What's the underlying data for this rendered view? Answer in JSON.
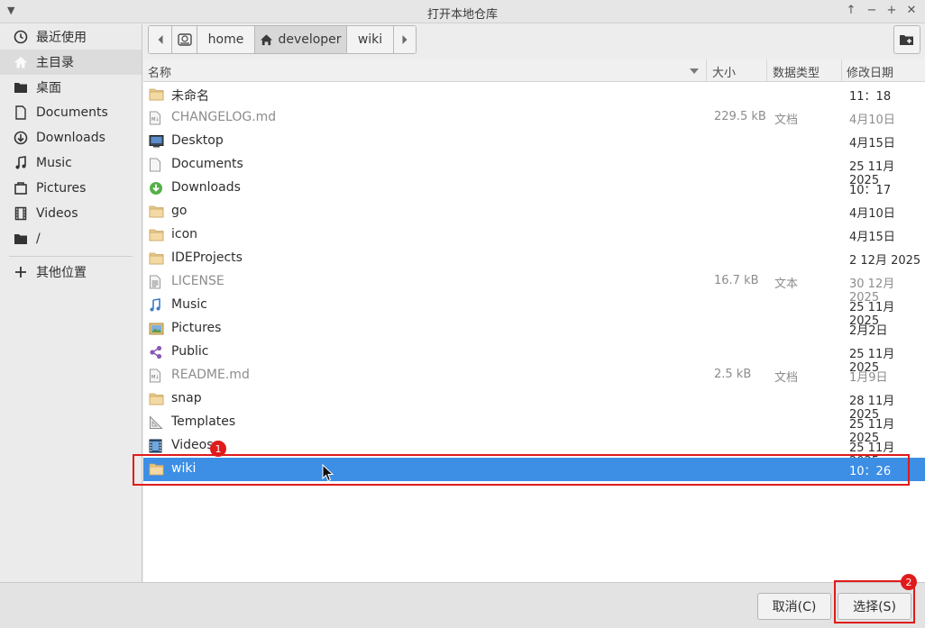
{
  "window": {
    "title": "打开本地仓库",
    "controls": [
      "↑",
      "−",
      "+",
      "✕"
    ]
  },
  "sidebar": {
    "items": [
      {
        "label": "最近使用",
        "icon": "recent-icon"
      },
      {
        "label": "主目录",
        "icon": "home-icon"
      },
      {
        "label": "桌面",
        "icon": "folder-icon"
      },
      {
        "label": "Documents",
        "icon": "document-icon"
      },
      {
        "label": "Downloads",
        "icon": "download-icon"
      },
      {
        "label": "Music",
        "icon": "music-icon"
      },
      {
        "label": "Pictures",
        "icon": "picture-icon"
      },
      {
        "label": "Videos",
        "icon": "video-icon"
      },
      {
        "label": "/",
        "icon": "folder-icon"
      }
    ],
    "other_locations": "其他位置"
  },
  "pathbar": {
    "segments": [
      "home",
      "developer",
      "wiki"
    ]
  },
  "table": {
    "headers": {
      "name": "名称",
      "size": "大小",
      "type": "数据类型",
      "modified": "修改日期"
    },
    "rows": [
      {
        "name": "未命名",
        "size": "",
        "type": "",
        "modified": "11：18",
        "icon": "folder-icon"
      },
      {
        "name": "CHANGELOG.md",
        "size": "229.5 kB",
        "type": "文档",
        "modified": "4月10日",
        "icon": "markdown-file-icon"
      },
      {
        "name": "Desktop",
        "size": "",
        "type": "",
        "modified": "4月15日",
        "icon": "desktop-folder-icon"
      },
      {
        "name": "Documents",
        "size": "",
        "type": "",
        "modified": "25 11月 2025",
        "icon": "documents-folder-icon"
      },
      {
        "name": "Downloads",
        "size": "",
        "type": "",
        "modified": "10：17",
        "icon": "downloads-folder-icon"
      },
      {
        "name": "go",
        "size": "",
        "type": "",
        "modified": "4月10日",
        "icon": "folder-icon"
      },
      {
        "name": "icon",
        "size": "",
        "type": "",
        "modified": "4月15日",
        "icon": "folder-icon"
      },
      {
        "name": "IDEProjects",
        "size": "",
        "type": "",
        "modified": "2 12月 2025",
        "icon": "folder-icon"
      },
      {
        "name": "LICENSE",
        "size": "16.7 kB",
        "type": "文本",
        "modified": "30 12月 2025",
        "icon": "text-file-icon"
      },
      {
        "name": "Music",
        "size": "",
        "type": "",
        "modified": "25 11月 2025",
        "icon": "music-folder-icon"
      },
      {
        "name": "Pictures",
        "size": "",
        "type": "",
        "modified": "2月2日",
        "icon": "pictures-folder-icon"
      },
      {
        "name": "Public",
        "size": "",
        "type": "",
        "modified": "25 11月 2025",
        "icon": "share-folder-icon"
      },
      {
        "name": "README.md",
        "size": "2.5 kB",
        "type": "文档",
        "modified": "1月9日",
        "icon": "markdown-file-icon"
      },
      {
        "name": "snap",
        "size": "",
        "type": "",
        "modified": "28 11月 2025",
        "icon": "folder-icon"
      },
      {
        "name": "Templates",
        "size": "",
        "type": "",
        "modified": "25 11月 2025",
        "icon": "templates-folder-icon"
      },
      {
        "name": "Videos",
        "size": "",
        "type": "",
        "modified": "25 11月 2025",
        "icon": "videos-folder-icon"
      },
      {
        "name": "wiki",
        "size": "",
        "type": "",
        "modified": "10：26",
        "icon": "folder-icon"
      }
    ]
  },
  "buttons": {
    "cancel": "取消(C)",
    "select": "选择(S)"
  },
  "annotations": [
    "1",
    "2"
  ],
  "colors": {
    "selection": "#3d8ee5",
    "annotation": "#e01b1b"
  }
}
